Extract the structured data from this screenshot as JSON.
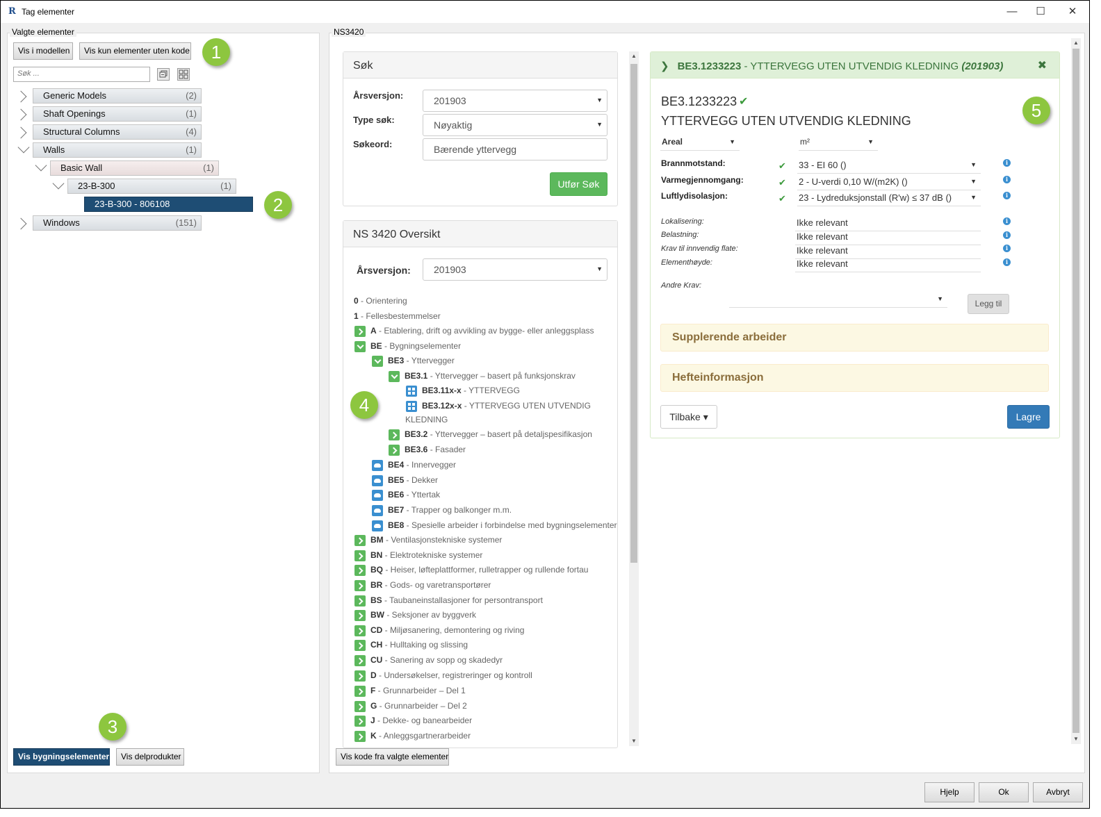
{
  "window": {
    "title": "Tag elementer",
    "minimize": "—",
    "maximize": "☐",
    "close": "✕",
    "app_icon": "R"
  },
  "left": {
    "group_label": "Valgte elementer",
    "btn_show_in_model": "Vis i modellen",
    "btn_show_without_code": "Vis kun elementer uten kode",
    "search_placeholder": "Søk ...",
    "tree": [
      {
        "label": "Generic Models",
        "count": "(2)"
      },
      {
        "label": "Shaft Openings",
        "count": "(1)"
      },
      {
        "label": "Structural Columns",
        "count": "(4)"
      },
      {
        "label": "Walls",
        "count": "(1)"
      },
      {
        "label": "Basic Wall",
        "count": "(1)"
      },
      {
        "label": "23-B-300",
        "count": "(1)"
      },
      {
        "label": "23-B-300 - 806108",
        "count": ""
      },
      {
        "label": "Windows",
        "count": "(151)"
      }
    ],
    "btn_building_elements": "Vis bygningselementer",
    "btn_subproducts": "Vis delprodukter"
  },
  "callouts": [
    "1",
    "2",
    "3",
    "4",
    "5"
  ],
  "middle": {
    "group_label": "NS3420",
    "search_panel": {
      "title": "Søk",
      "year_label": "Årsversjon:",
      "year_value": "201903",
      "type_label": "Type søk:",
      "type_value": "Nøyaktig",
      "keyword_label": "Søkeord:",
      "keyword_value": "Bærende yttervegg",
      "search_btn": "Utfør Søk"
    },
    "overview_panel": {
      "title": "NS 3420 Oversikt",
      "year_label": "Årsversjon:",
      "year_value": "201903"
    },
    "tree": [
      {
        "code": "0",
        "text": " - Orientering"
      },
      {
        "code": "1",
        "text": " - Fellesbestemmelser"
      },
      {
        "code": "A",
        "text": " - Etablering, drift og avvikling av bygge- eller anleggsplass"
      },
      {
        "code": "BE",
        "text": " - Bygningselementer"
      },
      {
        "code": "BE3",
        "text": " - Yttervegger"
      },
      {
        "code": "BE3.1",
        "text": " - Yttervegger – basert på funksjonskrav"
      },
      {
        "code": "BE3.11x-x",
        "text": " - YTTERVEGG"
      },
      {
        "code": "BE3.12x-x",
        "text": " - YTTERVEGG UTEN UTVENDIG",
        "cont": "KLEDNING"
      },
      {
        "code": "BE3.2",
        "text": " - Yttervegger – basert på detaljspesifikasjon"
      },
      {
        "code": "BE3.6",
        "text": " - Fasader"
      },
      {
        "code": "BE4",
        "text": " - Innervegger"
      },
      {
        "code": "BE5",
        "text": " - Dekker"
      },
      {
        "code": "BE6",
        "text": " - Yttertak"
      },
      {
        "code": "BE7",
        "text": " - Trapper og balkonger m.m."
      },
      {
        "code": "BE8",
        "text": " - Spesielle arbeider i forbindelse med bygningselementer"
      },
      {
        "code": "BM",
        "text": " - Ventilasjonstekniske systemer"
      },
      {
        "code": "BN",
        "text": " - Elektrotekniske systemer"
      },
      {
        "code": "BQ",
        "text": " - Heiser, løfteplattformer, rulletrapper og rullende fortau"
      },
      {
        "code": "BR",
        "text": " - Gods- og varetransportører"
      },
      {
        "code": "BS",
        "text": " - Taubaneinstallasjoner for persontransport"
      },
      {
        "code": "BW",
        "text": " - Seksjoner av byggverk"
      },
      {
        "code": "CD",
        "text": " - Miljøsanering, demontering og riving"
      },
      {
        "code": "CH",
        "text": " - Hulltaking og slissing"
      },
      {
        "code": "CU",
        "text": " - Sanering av sopp og skadedyr"
      },
      {
        "code": "D",
        "text": " - Undersøkelser, registreringer og kontroll"
      },
      {
        "code": "F",
        "text": " - Grunnarbeider – Del 1"
      },
      {
        "code": "G",
        "text": " - Grunnarbeider – Del 2"
      },
      {
        "code": "J",
        "text": " - Dekke- og banearbeider"
      },
      {
        "code": "K",
        "text": " - Anleggsgartnerarbeider"
      }
    ],
    "btn_show_code": "Vis kode fra valgte elementer"
  },
  "detail": {
    "header_code": "BE3.1233223",
    "header_title": " - YTTERVEGG UTEN UTVENDIG KLEDNING ",
    "header_year": "(201903)",
    "close": "✖",
    "code": "BE3.1233223",
    "check": "✔",
    "title": "YTTERVEGG UTEN UTVENDIG KLEDNING",
    "unit_type": "Areal",
    "unit": "m²",
    "props": [
      {
        "label": "Brannmotstand:",
        "value": "33 - EI 60 ()"
      },
      {
        "label": "Varmegjennomgang:",
        "value": "2 - U-verdi 0,10 W/(m2K) ()"
      },
      {
        "label": "Luftlydisolasjon:",
        "value": "23 - Lydreduksjonstall (R'w) ≤ 37 dB ()"
      }
    ],
    "extra": [
      {
        "label": "Lokalisering:",
        "value": "Ikke relevant"
      },
      {
        "label": "Belastning:",
        "value": "Ikke relevant"
      },
      {
        "label": "Krav til innvendig flate:",
        "value": "Ikke relevant"
      },
      {
        "label": "Elementhøyde:",
        "value": "Ikke relevant"
      }
    ],
    "other_label": "Andre Krav:",
    "add_btn": "Legg til",
    "supplementary": "Supplerende arbeider",
    "booklet": "Hefteinformasjon",
    "back_btn": "Tilbake ▾",
    "save_btn": "Lagre"
  },
  "footer": {
    "help": "Hjelp",
    "ok": "Ok",
    "cancel": "Avbryt"
  },
  "colors": {
    "accent_dark": "#1e4d74",
    "green": "#5cb85c",
    "blue": "#3a8fd0",
    "callout": "#8dc63f"
  }
}
